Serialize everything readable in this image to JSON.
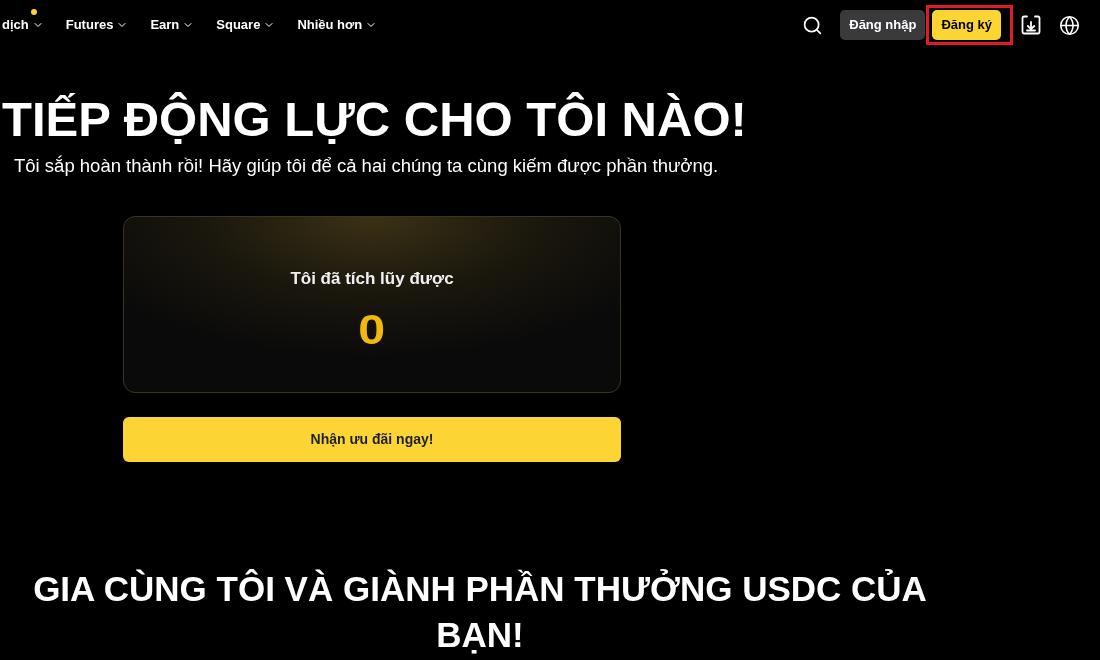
{
  "nav": {
    "items": [
      {
        "label": "dịch",
        "dot": true
      },
      {
        "label": "Futures",
        "dot": false
      },
      {
        "label": "Earn",
        "dot": false
      },
      {
        "label": "Square",
        "dot": false
      },
      {
        "label": "Nhiều hơn",
        "dot": false
      }
    ],
    "login_button": {
      "label": "Đăng nhập"
    },
    "register_button": {
      "label": "Đăng ký",
      "highlighted": true
    }
  },
  "hero": {
    "title": "TIẾP ĐỘNG LỰC CHO TÔI NÀO!",
    "subtitle": "Tôi sắp hoàn thành rồi! Hãy giúp tôi để cả hai chúng ta cùng kiếm được phần thưởng."
  },
  "reward_card": {
    "label": "Tôi đã tích lũy được",
    "amount": "0"
  },
  "cta_button": {
    "label": "Nhận ưu đãi ngay!"
  },
  "section": {
    "title": "GIA CÙNG TÔI VÀ GIÀNH PHẦN THƯỞNG USDC CỦA BẠN!"
  }
}
